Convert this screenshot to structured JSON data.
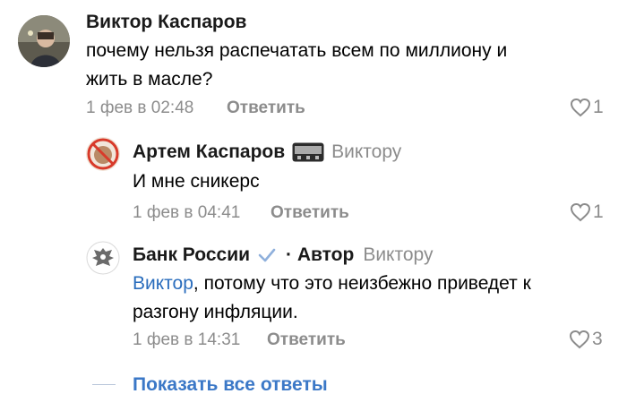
{
  "comments": [
    {
      "author": "Виктор Каспаров",
      "text_line1": "почему нельзя распечатать всем по миллиону и",
      "text_line2": "жить в масле?",
      "date": "1 фев в 02:48",
      "reply_label": "Ответить",
      "likes": "1"
    },
    {
      "author": "Артем Каспаров",
      "badge_icon": "pager-icon",
      "reply_to": "Виктору",
      "text": "И мне сникерс",
      "date": "1 фев в 04:41",
      "reply_label": "Ответить",
      "likes": "1"
    },
    {
      "author": "Банк России",
      "verified_icon": "checkmark-icon",
      "author_tag": "· Автор",
      "reply_to": "Виктору",
      "mention": "Виктор",
      "text_rest": ", потому что это неизбежно приведет к",
      "text_line2": "разгону инфляции.",
      "date": "1 фев в 14:31",
      "reply_label": "Ответить",
      "likes": "3"
    }
  ],
  "show_all_label": "Показать все ответы",
  "colors": {
    "accent": "#3b78c7",
    "muted": "#8c8c8c",
    "like_outline": "#8c8c8c"
  }
}
